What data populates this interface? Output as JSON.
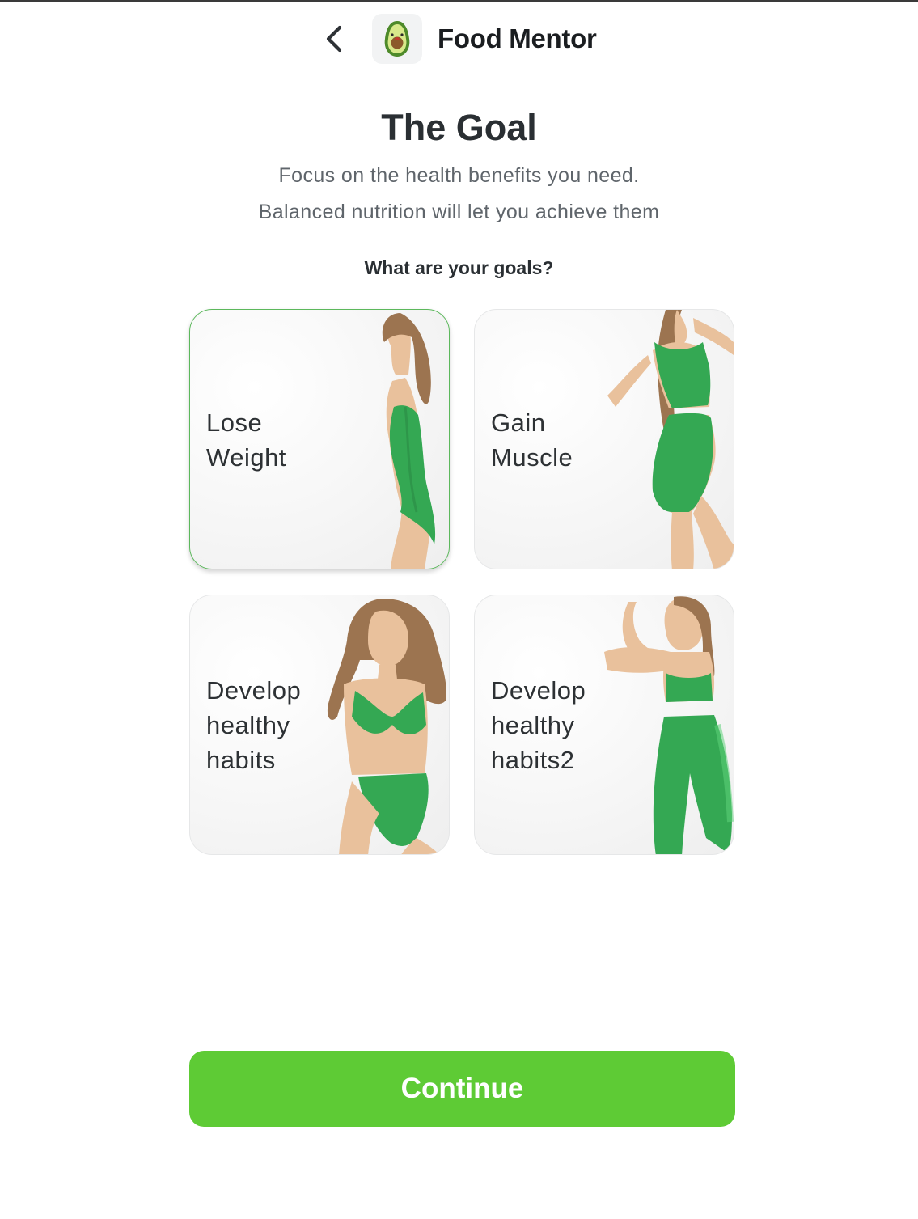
{
  "header": {
    "back_icon": "chevron-left-icon",
    "logo_icon": "avocado-icon",
    "brand": "Food Mentor"
  },
  "intro": {
    "title": "The Goal",
    "subtitle_line1": "Focus on the health benefits you need.",
    "subtitle_line2": "Balanced nutrition will let you achieve them",
    "question": "What are your goals?"
  },
  "goals": [
    {
      "label": "Lose\nWeight",
      "selected": true
    },
    {
      "label": "Gain\nMuscle",
      "selected": false
    },
    {
      "label": "Develop\nhealthy\nhabits",
      "selected": false
    },
    {
      "label": "Develop\nhealthy\nhabits2",
      "selected": false
    }
  ],
  "colors": {
    "accent": "#5ecb35",
    "selected_border": "#5cb85c",
    "outfit_green": "#34a853",
    "skin": "#e9c19c",
    "hair": "#9c7450"
  },
  "footer": {
    "continue_label": "Continue"
  }
}
